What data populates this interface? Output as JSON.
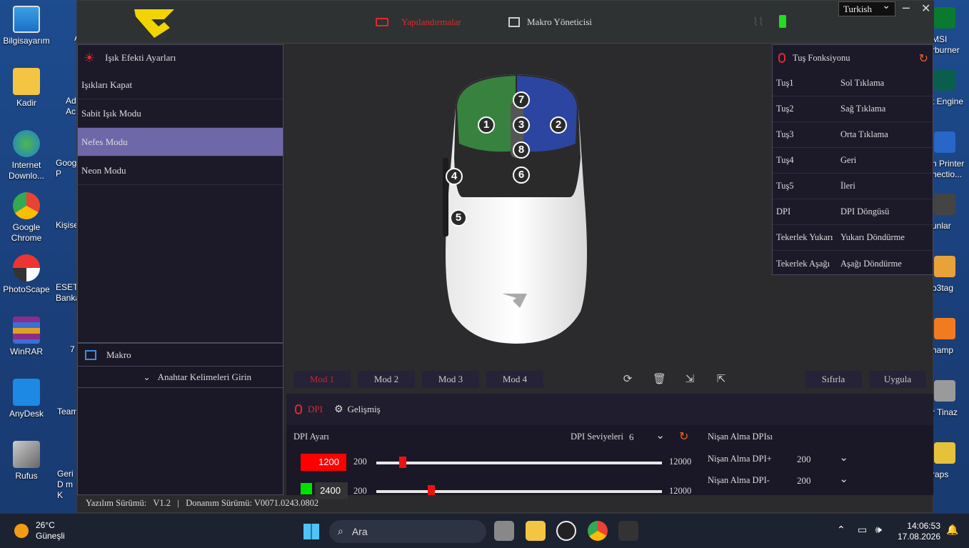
{
  "desktop": {
    "left_icons": [
      {
        "label": "Bilgisayarım"
      },
      {
        "label": "Kadir"
      },
      {
        "label": "Internet Downlo..."
      },
      {
        "label": "Google Chrome"
      },
      {
        "label": "PhotoScape"
      },
      {
        "label": "WinRAR"
      },
      {
        "label": "AnyDesk"
      },
      {
        "label": "Rufus"
      }
    ],
    "second_col": [
      "A",
      "Ad Acı",
      "Goog P",
      "Kişise",
      "ESET Banka",
      "7",
      "Team",
      "Geri D m K"
    ],
    "right_labels": [
      "MSI rburner",
      "t Engine",
      "n Printer nectio...",
      "unlar",
      "p3tag",
      "hamp",
      "r Tinaz",
      "raps"
    ]
  },
  "app": {
    "nav_config": "Yapılandırmalar",
    "nav_macro": "Makro Yöneticisi",
    "language": "Turkish",
    "left_panel": {
      "title": "Işık Efekti Ayarları",
      "items": [
        "Işıkları Kapat",
        "Sabit Işık Modu",
        "Nefes Modu",
        "Neon Modu"
      ]
    },
    "macro_panel": {
      "title": "Makro",
      "keywords": "Anahtar Kelimeleri Girin"
    },
    "key_panel": {
      "title": "Tuş Fonksiyonu",
      "rows": [
        {
          "key": "Tuş1",
          "value": "Sol Tıklama"
        },
        {
          "key": "Tuş2",
          "value": "Sağ Tıklama"
        },
        {
          "key": "Tuş3",
          "value": "Orta Tıklama"
        },
        {
          "key": "Tuş4",
          "value": "Geri"
        },
        {
          "key": "Tuş5",
          "value": "İleri"
        },
        {
          "key": "DPI",
          "value": "DPI Döngüsü"
        },
        {
          "key": "Tekerlek Yukarı",
          "value": "Yukarı Döndürme"
        },
        {
          "key": "Tekerlek Aşağı",
          "value": "Aşağı Döndürme"
        }
      ]
    },
    "mouse_badges": [
      "1",
      "2",
      "3",
      "4",
      "5",
      "6",
      "7",
      "8"
    ],
    "modes": [
      "Mod 1",
      "Mod 2",
      "Mod 3",
      "Mod 4"
    ],
    "reset": "Sıfırla",
    "apply": "Uygula",
    "dpi": {
      "tab_dpi": "DPI",
      "tab_advanced": "Gelişmiş",
      "dpi_label": "DPI Ayarı",
      "levels_label": "DPI Seviyeleri",
      "levels_value": "6",
      "aim_title": "Nişan Alma DPIsı",
      "aim_plus_label": "Nişan Alma DPI+",
      "aim_plus_value": "200",
      "aim_minus_label": "Nişan Alma DPI-",
      "aim_minus_value": "200",
      "rows": [
        {
          "value": "1200",
          "min": "200",
          "max": "12000",
          "color": "#ff0000",
          "fraction": 0.08
        },
        {
          "value": "2400",
          "min": "200",
          "max": "12000",
          "color": "#00e000",
          "fraction": 0.19
        }
      ]
    },
    "status": {
      "software_label": "Yazılım Sürümü:",
      "software_value": "V1.2",
      "sep": "|",
      "hardware_label": "Donanım Sürümü:",
      "hardware_value": "V0071.0243.0802"
    }
  },
  "taskbar": {
    "temp": "26°C",
    "weather": "Güneşli",
    "search_placeholder": "Ara",
    "time": "14:06:53",
    "date": "17.08.2026"
  }
}
